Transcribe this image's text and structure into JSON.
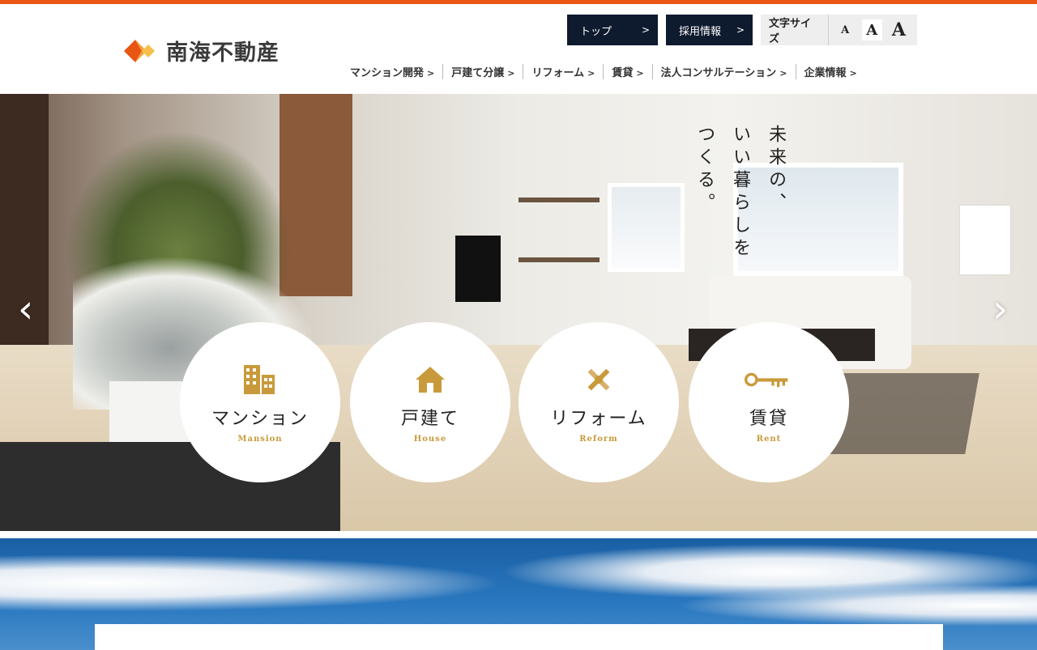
{
  "brand": {
    "name": "南海不動産",
    "accent": "#e95513",
    "navy": "#0e1a2e"
  },
  "utility": {
    "top_label": "トップ",
    "recruit_label": "採用情報",
    "font_size_label": "文字サイズ",
    "font_small": "A",
    "font_medium": "A",
    "font_large": "A"
  },
  "nav": {
    "items": [
      {
        "label": "マンション開発"
      },
      {
        "label": "戸建て分譲"
      },
      {
        "label": "リフォーム"
      },
      {
        "label": "賃貸"
      },
      {
        "label": "法人コンサルテーション"
      },
      {
        "label": "企業情報"
      }
    ]
  },
  "hero": {
    "tagline": [
      "未来の、",
      "いい暮らしを",
      "つくる。"
    ],
    "prev_icon": "‹",
    "next_icon": "›"
  },
  "categories": [
    {
      "title": "マンション",
      "en": "Mansion",
      "icon": "building-icon"
    },
    {
      "title": "戸建て",
      "en": "House",
      "icon": "house-icon"
    },
    {
      "title": "リフォーム",
      "en": "Reform",
      "icon": "tools-icon"
    },
    {
      "title": "賃貸",
      "en": "Rent",
      "icon": "key-icon"
    }
  ]
}
